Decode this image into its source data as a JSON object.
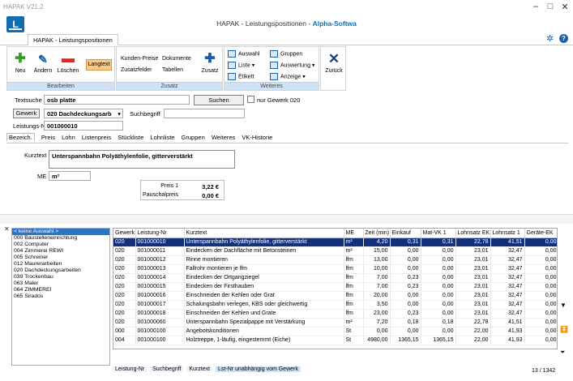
{
  "window": {
    "app_version": "HAPAK V21.2",
    "title_main": "HAPAK - Leistungspositionen - ",
    "title_brand": "Alpha-Softwa",
    "logo_letter": "L",
    "minimize": "–",
    "maximize": "□",
    "close": "✕"
  },
  "tabs": {
    "main": "HAPAK - Leistungspositionen"
  },
  "ribbon": {
    "bearbeiten": {
      "caption": "Bearbeiten",
      "neu": "Neu",
      "aendern": "Ändern",
      "loeschen": "Löschen",
      "langtext": "Langtext"
    },
    "zusatz": {
      "caption": "Zusatz",
      "kunden_preise": "Kunden-Preise",
      "dokumente": "Dokumente",
      "zusatzfelder": "Zusatzfelder",
      "tabellen": "Tabellen",
      "zusatz": "Zusatz"
    },
    "weiteres": {
      "caption": "Weiteres",
      "auswahl": "Auswahl",
      "liste": "Liste",
      "etikett": "Etikett",
      "gruppen": "Gruppen",
      "auswertung": "Auswertung",
      "anzeige": "Anzeige"
    },
    "zurueck": "Zurück"
  },
  "search": {
    "textsuche_label": "Textsuche",
    "textsuche_value": "osb platte",
    "suchen_button": "Suchen",
    "nur_gewerk_label": "nur Gewerk 020",
    "gewerk_button": "Gewerk",
    "gewerk_value": "020 Dachdeckungsarb",
    "suchbegriff_label": "Suchbegriff",
    "suchbegriff_value": "",
    "leistungsnr_label": "Leistungs-Nr",
    "leistungsnr_value": "001000010"
  },
  "subtabs": [
    "Bezeich.",
    "Preis",
    "Lohn",
    "Listenpreis",
    "Stückliste",
    "Lohnliste",
    "Gruppen",
    "Weiteres",
    "VK-Historie"
  ],
  "detail": {
    "kurztext_label": "Kurztext",
    "kurztext_value": "Unterspannbahn Polyäthylenfolie, gitterverstärkt",
    "me_label": "ME",
    "me_value": "m²",
    "preis1_label": "Preis 1",
    "preis1_value": "3,22 €",
    "pauschal_label": "Pauschalpreis",
    "pauschal_value": "0,00 €"
  },
  "gewerk_list": [
    "< keine Auswahl >",
    "000 Baustelleneinrichtung",
    "002 Computer",
    "004 Zimmerei REWI",
    "005 Schreiner",
    "012 Maurerarbeiten",
    "020 Dachdeckungsarbeiten",
    "039 Trockenbau",
    "063 Maler",
    "064 ZIMMEREI",
    "065 Sirados"
  ],
  "grid": {
    "columns": [
      "Gewerk",
      "Leistung-Nr",
      "Kurztext",
      "ME",
      "Zeit (min)",
      "Einkauf",
      "Mat-VK 1",
      "Lohnsatz EK",
      "Lohnsatz 1",
      "Geräte-EK"
    ],
    "rows": [
      [
        "020",
        "001000010",
        "Unterspannbahn Polyäthylenfolie, gitterverstärkt",
        "m²",
        "4,20",
        "0,31",
        "0,31",
        "22,78",
        "41,51",
        "0,00"
      ],
      [
        "020",
        "001000011",
        "Eindecken der Dachfläche mit Betonsteinen",
        "m²",
        "15,00",
        "0,00",
        "0,00",
        "23,01",
        "32,47",
        "0,00"
      ],
      [
        "020",
        "001000012",
        "Rinne montieren",
        "lfm",
        "13,00",
        "0,00",
        "0,00",
        "23,01",
        "32,47",
        "0,00"
      ],
      [
        "020",
        "001000013",
        "Fallrohr montieren je  lfm",
        "lfm",
        "10,00",
        "0,00",
        "0,00",
        "23,01",
        "32,47",
        "0,00"
      ],
      [
        "020",
        "001000014",
        "Eindecken der Ortgangziegel",
        "lfm",
        "7,00",
        "0,23",
        "0,00",
        "23,01",
        "32,47",
        "0,00"
      ],
      [
        "020",
        "001000015",
        "Eindecken der Firsthauben",
        "lfm",
        "7,00",
        "0,23",
        "0,00",
        "23,01",
        "32,47",
        "0,00"
      ],
      [
        "020",
        "001000016",
        "Einschneiden der Kehlen oder Grat",
        "lfm",
        "20,00",
        "0,00",
        "0,00",
        "23,01",
        "32,47",
        "0,00"
      ],
      [
        "020",
        "001000017",
        "Schalungsbahn verlegen, KBS oder gleichwertig",
        "lfm",
        "3,50",
        "0,00",
        "0,00",
        "23,01",
        "32,47",
        "0,00"
      ],
      [
        "020",
        "001000018",
        "Einschneiden der Kehlen und Grate",
        "lfm",
        "23,00",
        "0,23",
        "0,00",
        "23,01",
        "32,47",
        "0,00"
      ],
      [
        "020",
        "001000060",
        "Unterspannbahn Spezialpappe mit Verstärkung",
        "m²",
        "7,20",
        "0,18",
        "0,18",
        "22,78",
        "41,51",
        "0,00"
      ],
      [
        "000",
        "001000100",
        "Angebotskonditionen",
        "St",
        "0,00",
        "0,00",
        "0,00",
        "22,00",
        "41,93",
        "0,00"
      ],
      [
        "004",
        "001000100",
        "Holztreppe, 1-läufig, eingestemmt (Eiche)",
        "St",
        "4980,00",
        "1365,15",
        "1365,15",
        "22,00",
        "41,93",
        "0,00"
      ]
    ]
  },
  "bottom_tabs": [
    "Leistung-Nr",
    "Suchbegriff",
    "Kurztext",
    "Lst-Nr unabhängig vom Gewerk"
  ],
  "counter": "13 / 1342",
  "icons": {
    "neu": "plus-icon",
    "aendern": "edit-icon",
    "loeschen": "minus-icon",
    "zusatz": "plus-icon",
    "zurueck": "close-icon",
    "settings": "gear-icon",
    "help": "question-icon"
  },
  "colors": {
    "accent": "#0e6eb0",
    "selection": "#14307a",
    "ribbon_caption": "#cfe2f3",
    "langtext": "#f8c98a",
    "plus_green": "#3a9b2c",
    "minus_red": "#d42b2b"
  }
}
